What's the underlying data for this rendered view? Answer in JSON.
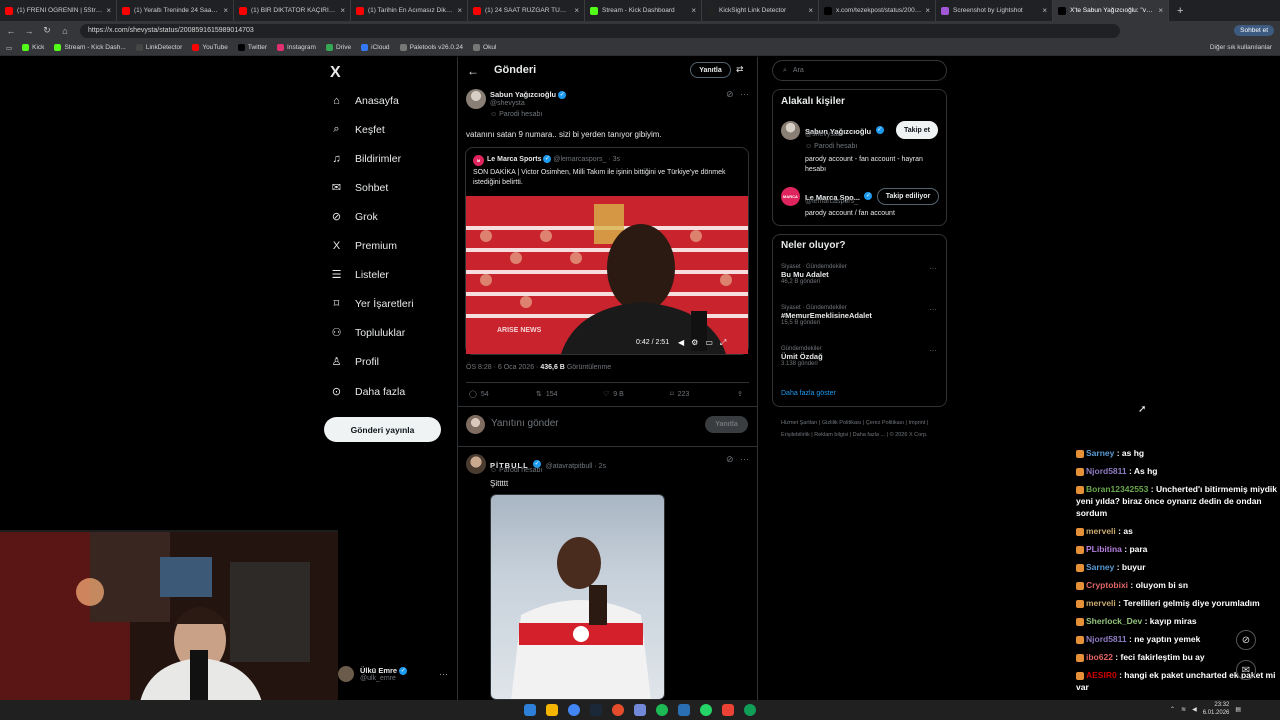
{
  "browser": {
    "tabs": [
      {
        "label": "(1) FRENİ ÖĞRENİN | 5Striders | M",
        "color": "#ff0000",
        "active": false
      },
      {
        "label": "(1) Yeraltı Treninde 24 Saat Hayatt",
        "color": "#ff0000",
        "active": false
      },
      {
        "label": "(1) BİR DİKTATÖR KAÇIRILIRSA NE",
        "color": "#ff0000",
        "active": false
      },
      {
        "label": "(1) Tarihin En Acımasız Diktatör O",
        "color": "#ff0000",
        "active": false
      },
      {
        "label": "(1) 24 SAAT RÜZGAR TÜRBİNİNE",
        "color": "#ff0000",
        "active": false
      },
      {
        "label": "Stream - Kick Dashboard",
        "color": "#53fc18",
        "active": false
      },
      {
        "label": "KickSight Link Detector",
        "color": "#222222",
        "active": false
      },
      {
        "label": "x.com/tezekpost/status/20085036",
        "color": "#000000",
        "active": false
      },
      {
        "label": "Screenshot by Lightshot",
        "color": "#a257d6",
        "active": false
      },
      {
        "label": "X'te Sabun Yağızcıoğlu: \"vatan",
        "color": "#000000",
        "active": true
      }
    ],
    "url": "https://x.com/shevysta/status/2008591615989014703",
    "profile_label": "Sohbet et",
    "bookmarks": [
      {
        "label": "Kick",
        "color": "#53fc18"
      },
      {
        "label": "Stream - Kick Dash...",
        "color": "#53fc18"
      },
      {
        "label": "LinkDetector",
        "color": "#444"
      },
      {
        "label": "YouTube",
        "color": "#ff0000"
      },
      {
        "label": "Twitter",
        "color": "#000"
      },
      {
        "label": "Instagram",
        "color": "#e1306c"
      },
      {
        "label": "Drive",
        "color": "#34a853"
      },
      {
        "label": "iCloud",
        "color": "#3478f6"
      },
      {
        "label": "Paletools v26.0.24",
        "color": "#777"
      },
      {
        "label": "Okul",
        "color": "#777"
      }
    ],
    "bookmarks_right": "Diğer sık kullanılanlar"
  },
  "nav": {
    "logo": "X",
    "items": [
      {
        "label": "Anasayfa",
        "icon": "⌂"
      },
      {
        "label": "Keşfet",
        "icon": "⌕"
      },
      {
        "label": "Bildirimler",
        "icon": "♫"
      },
      {
        "label": "Sohbet",
        "icon": "✉"
      },
      {
        "label": "Grok",
        "icon": "⊘"
      },
      {
        "label": "Premium",
        "icon": "X"
      },
      {
        "label": "Listeler",
        "icon": "☰"
      },
      {
        "label": "Yer İşaretleri",
        "icon": "⌑"
      },
      {
        "label": "Topluluklar",
        "icon": "⚇"
      },
      {
        "label": "Profil",
        "icon": "♙"
      },
      {
        "label": "Daha fazla",
        "icon": "⊙"
      }
    ],
    "post_button": "Gönderi yayınla",
    "account": {
      "name": "Ülkü Emre",
      "handle": "@ulk_emre"
    }
  },
  "main": {
    "header_title": "Gönderi",
    "header_reply": "Yanıtla",
    "post": {
      "name": "Sabun Yağızcıoğlu",
      "handle": "@shevysta",
      "parody": "Parodi hesabı",
      "text": "vatanını satan 9 numara.. sizi bi yerden tanıyor gibiyim.",
      "quote": {
        "name": "Le Marca Sports",
        "handle": "@lemarcaspors_ · 3s",
        "text": "SON DAKİKA | Victor Osimhen, Milli Takım ile işinin bittiğini ve Türkiye'ye dönmek istediğini belirtti.",
        "video_time": "0:42 / 2:51",
        "video_logo": "ARISE NEWS"
      },
      "time": "ÖS 8:28 · 6 Oca 2026 · ",
      "views": "436,6 B",
      "views_label": "Görüntülenme",
      "replies": "54",
      "reposts": "154",
      "likes": "9 B",
      "bookmarks": "223"
    },
    "reply_placeholder": "Yanıtını gönder",
    "reply_button": "Yanıtla",
    "reply_post": {
      "name": "PİTBULL",
      "handle": "@atavratpitbull · 2s",
      "parody": "Parodi hesabı",
      "text": "Şittttt"
    }
  },
  "sidebar": {
    "search_placeholder": "Ara",
    "related_title": "Alakalı kişiler",
    "users": [
      {
        "name": "Sabun Yağızcıoğlu",
        "handle": "@shevysta",
        "parody": "Parodi hesabı",
        "bio": "parody account - fan account - hayran hesabı",
        "button": "Takip et"
      },
      {
        "name": "Le Marca Spo...",
        "handle": "@lemarcaspors_",
        "bio": "parody account / fan account",
        "button": "Takip ediliyor"
      }
    ],
    "trends_title": "Neler oluyor?",
    "trends": [
      {
        "category": "Siyaset · Gündemdekiler",
        "name": "Bu Mu Adalet",
        "count": "46,2 B gönderi"
      },
      {
        "category": "Siyaset · Gündemdekiler",
        "name": "#MemurEmeklisineAdalet",
        "count": "15,5 B gönderi"
      },
      {
        "category": "Gündemdekiler",
        "name": "Ümit Özdağ",
        "count": "3.138 gönderi"
      }
    ],
    "show_more": "Daha fazla göster",
    "footer": [
      "Hizmet Şartları",
      "Gizlilik Politikası",
      "Çerez Politikası",
      "Imprint",
      "Erişilebilirlik",
      "Reklam bilgisi",
      "Daha fazla ...",
      "© 2026 X Corp."
    ]
  },
  "chat": [
    {
      "user": "Sarney",
      "color": "#5b9bd5",
      "msg": "as hg"
    },
    {
      "user": "Njord5811",
      "color": "#8e7cc3",
      "msg": "As hg"
    },
    {
      "user": "Boran12342553",
      "color": "#6aa84f",
      "msg": "Uncherted'ı bitirmemiş miydik yeni yılda? biraz önce oynarız dedin de ondan sordum"
    },
    {
      "user": "merveli",
      "color": "#c9a96e",
      "msg": "as"
    },
    {
      "user": "PLibitina",
      "color": "#b57edc",
      "msg": "para"
    },
    {
      "user": "Sarney",
      "color": "#5b9bd5",
      "msg": "buyur"
    },
    {
      "user": "Cryptobixi",
      "color": "#e06666",
      "msg": "oluyom bi sn"
    },
    {
      "user": "merveli",
      "color": "#c9a96e",
      "msg": "Terellileri gelmiş diye yorumladım"
    },
    {
      "user": "Sherlock_Dev",
      "color": "#93c47d",
      "msg": "kayıp miras"
    },
    {
      "user": "Njord5811",
      "color": "#8e7cc3",
      "msg": "ne yaptın yemek"
    },
    {
      "user": "ibo622",
      "color": "#e06666",
      "msg": "feci fakirleştim bu ay"
    },
    {
      "user": "AESIR0",
      "color": "#cc0000",
      "msg": "hangi ek paket uncharted ek paket mi var"
    }
  ],
  "taskbar": {
    "time": "23:32",
    "date": "6.01.2026"
  }
}
